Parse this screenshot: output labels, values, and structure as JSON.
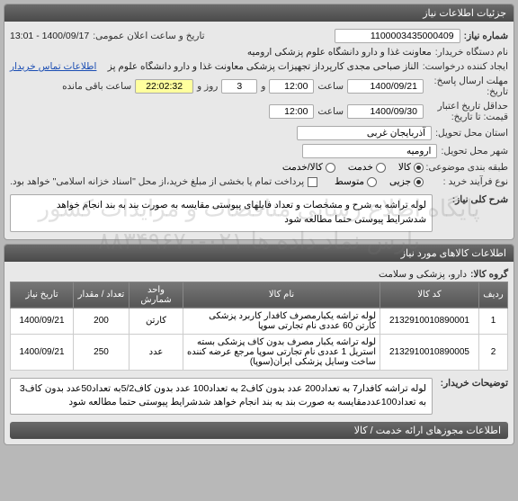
{
  "panel1": {
    "title": "جزئیات اطلاعات نیاز",
    "need_no_lbl": "شماره نیاز:",
    "need_no": "1100003435000409",
    "pubdate_lbl": "تاریخ و ساعت اعلان عمومی:",
    "pubdate": "1400/09/17 - 13:01",
    "org_lbl": "نام دستگاه خریدار:",
    "org": "معاونت غذا و دارو دانشگاه علوم پزشکی ارومیه",
    "creator_lbl": "ایجاد کننده درخواست:",
    "creator": "الناز صباحی مجدی کارپرداز تجهیزات پزشکی معاونت غذا و دارو دانشگاه علوم پز",
    "contact_link": "اطلاعات تماس خریدار",
    "deadline_lbl": "مهلت ارسال پاسخ:",
    "deadline_sub": "تاریخ:",
    "deadline_date": "1400/09/21",
    "time_lbl": "ساعت",
    "deadline_time": "12:00",
    "and_lbl": "و",
    "days": "3",
    "day_lbl": "روز و",
    "countdown": "22:02:32",
    "remain_lbl": "ساعت باقی مانده",
    "credit_lbl": "حداقل تاریخ اعتبار",
    "credit_sub": "قیمت: تا تاریخ:",
    "credit_date": "1400/09/30",
    "credit_time": "12:00",
    "province_lbl": "استان محل تحویل:",
    "province": "آذربایجان غربی",
    "city_lbl": "شهر محل تحویل:",
    "city": "ارومیه",
    "class_lbl": "طبقه بندی موضوعی:",
    "radio_goods": "کالا",
    "radio_service": "خدمت",
    "radio_both": "کالا/خدمت",
    "proc_lbl": "نوع فرآیند خرید :",
    "radio_part": "جزیی",
    "radio_med": "متوسط",
    "pay_note": "پرداخت تمام یا بخشی از مبلغ خرید،از محل \"اسناد خزانه اسلامی\" خواهد بود.",
    "summary_lbl": "شرح کلی نیاز:",
    "summary": "لوله تراشه به شرح و مشخصات و تعداد فایلهای پیوستی مقایسه به صورت بند به بند انجام خواهد شدشرایط پیوستی حتما مطالعه شود"
  },
  "panel2": {
    "title": "اطلاعات کالاهای مورد نیاز",
    "group_lbl": "گروه کالا:",
    "group": "دارو، پزشکی و سلامت",
    "cols": {
      "row": "ردیف",
      "code": "کد کالا",
      "name": "نام کالا",
      "unit": "واحد شمارش",
      "qty": "تعداد / مقدار",
      "date": "تاریخ نیاز"
    },
    "rows": [
      {
        "r": "1",
        "code": "2132910010890001",
        "name": "لوله تراشه یکبارمصرف کافدار کاربرد پزشکی کارتن 60 عددی نام تجارتی سوپا",
        "unit": "کارتن",
        "qty": "200",
        "date": "1400/09/21"
      },
      {
        "r": "2",
        "code": "2132910010890005",
        "name": "لوله تراشه یکبار مصرف بدون کاف پزشکی بسته استریل 1 عددی نام تجارتی سوپا مرجع عرضه کننده ساخت وسایل پزشکی ایران(سوپا)",
        "unit": "عدد",
        "qty": "250",
        "date": "1400/09/21"
      }
    ],
    "buyer_desc_lbl": "توضیحات خریدار:",
    "buyer_desc": "لوله تراشه کافدار7 به تعداد200 عدد بدون کاف2 به تعداد100 عدد بدون کاف5/2به تعداد50عدد بدون کاف3 به تعداد100عددمقایسه به صورت بند به بند انجام خواهد شدشرایط پیوستی حتما مطالعه شود",
    "footer": "اطلاعات مجوزهای ارائه خدمت / کالا"
  },
  "watermark": {
    "line1": "پایگاه اطلاع رسانی مناقصات و مزایدات کشور",
    "line2": "پارس نماد داده ها ۰۲۱-۸۸۳۴۹۶۷۰"
  }
}
